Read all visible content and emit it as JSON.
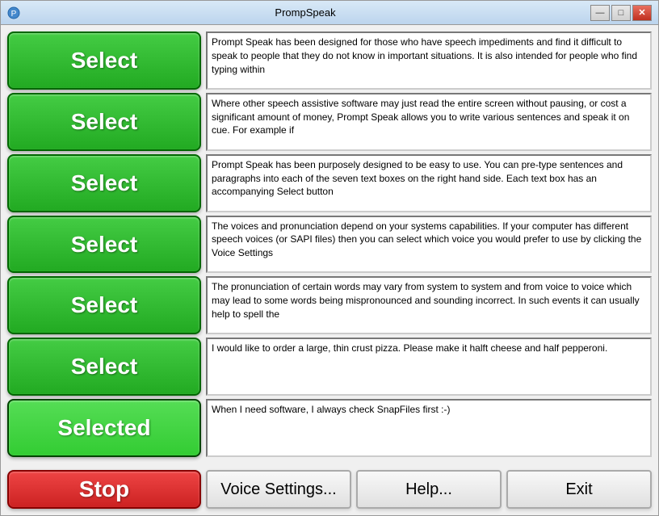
{
  "window": {
    "title": "PrompSpeak",
    "icon": "speech-icon"
  },
  "titlebar": {
    "minimize_label": "—",
    "restore_label": "□",
    "close_label": "✕"
  },
  "rows": [
    {
      "id": "row1",
      "button_label": "Select",
      "is_selected": false,
      "text": "Prompt Speak has been designed for those who have speech impediments and find it difficult to speak to people that they do not know in important situations. It is also intended for people who find typing within"
    },
    {
      "id": "row2",
      "button_label": "Select",
      "is_selected": false,
      "text": "Where other speech assistive software may just read the entire screen without pausing, or cost a significant amount of money, Prompt Speak allows you to write various sentences and speak it on cue. For example if"
    },
    {
      "id": "row3",
      "button_label": "Select",
      "is_selected": false,
      "text": "Prompt Speak has been purposely designed to be easy to use. You can pre-type sentences and paragraphs into each of the seven text boxes on the right hand side. Each text box has an accompanying Select button"
    },
    {
      "id": "row4",
      "button_label": "Select",
      "is_selected": false,
      "text": "The voices and pronunciation depend on your systems capabilities. If your computer has different speech voices (or SAPI files) then you can select which voice you would prefer to use by clicking the Voice Settings"
    },
    {
      "id": "row5",
      "button_label": "Select",
      "is_selected": false,
      "text": "The pronunciation of certain words may vary from system to system and from voice to voice which may lead to some words being mispronounced and sounding incorrect. In such events it can usually help to spell the"
    },
    {
      "id": "row6",
      "button_label": "Select",
      "is_selected": false,
      "text": "I would like to order a large, thin crust pizza. Please make it halft cheese and half pepperoni."
    },
    {
      "id": "row7",
      "button_label": "Selected",
      "is_selected": true,
      "text": "When I need software, I always check SnapFiles first :-)"
    }
  ],
  "bottom": {
    "stop_label": "Stop",
    "voice_settings_label": "Voice Settings...",
    "help_label": "Help...",
    "exit_label": "Exit"
  }
}
